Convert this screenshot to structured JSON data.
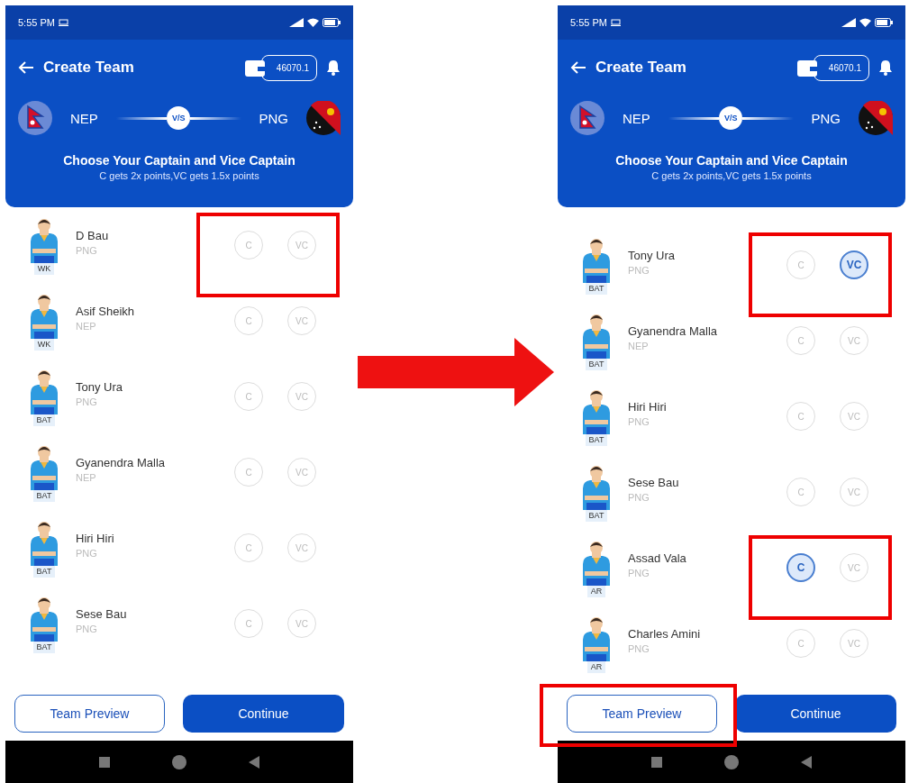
{
  "screens": [
    {
      "status_bar": {
        "time": "5:55 PM"
      },
      "header": {
        "title": "Create Team",
        "balance": "46070.1"
      },
      "match": {
        "team_1": "NEP",
        "vs": "V/S",
        "team_2": "PNG"
      },
      "instruction": {
        "title": "Choose Your Captain and Vice Captain",
        "subtitle": "C gets 2x points,VC gets 1.5x points"
      },
      "players": [
        {
          "name": "D Bau",
          "team": "PNG",
          "role": "WK",
          "captain": {
            "label": "C",
            "selected": false
          },
          "vice_captain": {
            "label": "VC",
            "selected": false
          },
          "highlighted": true
        },
        {
          "name": "Asif Sheikh",
          "team": "NEP",
          "role": "WK",
          "captain": {
            "label": "C",
            "selected": false
          },
          "vice_captain": {
            "label": "VC",
            "selected": false
          },
          "highlighted": false
        },
        {
          "name": "Tony Ura",
          "team": "PNG",
          "role": "BAT",
          "captain": {
            "label": "C",
            "selected": false
          },
          "vice_captain": {
            "label": "VC",
            "selected": false
          },
          "highlighted": false
        },
        {
          "name": "Gyanendra Malla",
          "team": "NEP",
          "role": "BAT",
          "captain": {
            "label": "C",
            "selected": false
          },
          "vice_captain": {
            "label": "VC",
            "selected": false
          },
          "highlighted": false
        },
        {
          "name": "Hiri Hiri",
          "team": "PNG",
          "role": "BAT",
          "captain": {
            "label": "C",
            "selected": false
          },
          "vice_captain": {
            "label": "VC",
            "selected": false
          },
          "highlighted": false
        },
        {
          "name": "Sese Bau",
          "team": "PNG",
          "role": "BAT",
          "captain": {
            "label": "C",
            "selected": false
          },
          "vice_captain": {
            "label": "VC",
            "selected": false
          },
          "highlighted": false
        }
      ],
      "footer": {
        "preview": "Team Preview",
        "continue": "Continue",
        "preview_highlighted": false
      }
    },
    {
      "status_bar": {
        "time": "5:55 PM"
      },
      "header": {
        "title": "Create Team",
        "balance": "46070.1"
      },
      "match": {
        "team_1": "NEP",
        "vs": "V/S",
        "team_2": "PNG"
      },
      "instruction": {
        "title": "Choose Your Captain and Vice Captain",
        "subtitle": "C gets 2x points,VC gets 1.5x points"
      },
      "players": [
        {
          "name": "Tony Ura",
          "team": "PNG",
          "role": "BAT",
          "captain": {
            "label": "C",
            "selected": false
          },
          "vice_captain": {
            "label": "VC",
            "selected": true
          },
          "highlighted": true
        },
        {
          "name": "Gyanendra Malla",
          "team": "NEP",
          "role": "BAT",
          "captain": {
            "label": "C",
            "selected": false
          },
          "vice_captain": {
            "label": "VC",
            "selected": false
          },
          "highlighted": false
        },
        {
          "name": "Hiri Hiri",
          "team": "PNG",
          "role": "BAT",
          "captain": {
            "label": "C",
            "selected": false
          },
          "vice_captain": {
            "label": "VC",
            "selected": false
          },
          "highlighted": false
        },
        {
          "name": "Sese Bau",
          "team": "PNG",
          "role": "BAT",
          "captain": {
            "label": "C",
            "selected": false
          },
          "vice_captain": {
            "label": "VC",
            "selected": false
          },
          "highlighted": false
        },
        {
          "name": "Assad Vala",
          "team": "PNG",
          "role": "AR",
          "captain": {
            "label": "C",
            "selected": true
          },
          "vice_captain": {
            "label": "VC",
            "selected": false
          },
          "highlighted": true
        },
        {
          "name": "Charles Amini",
          "team": "PNG",
          "role": "AR",
          "captain": {
            "label": "C",
            "selected": false
          },
          "vice_captain": {
            "label": "VC",
            "selected": false
          },
          "highlighted": false
        }
      ],
      "footer": {
        "preview": "Team Preview",
        "continue": "Continue",
        "preview_highlighted": true
      }
    }
  ]
}
